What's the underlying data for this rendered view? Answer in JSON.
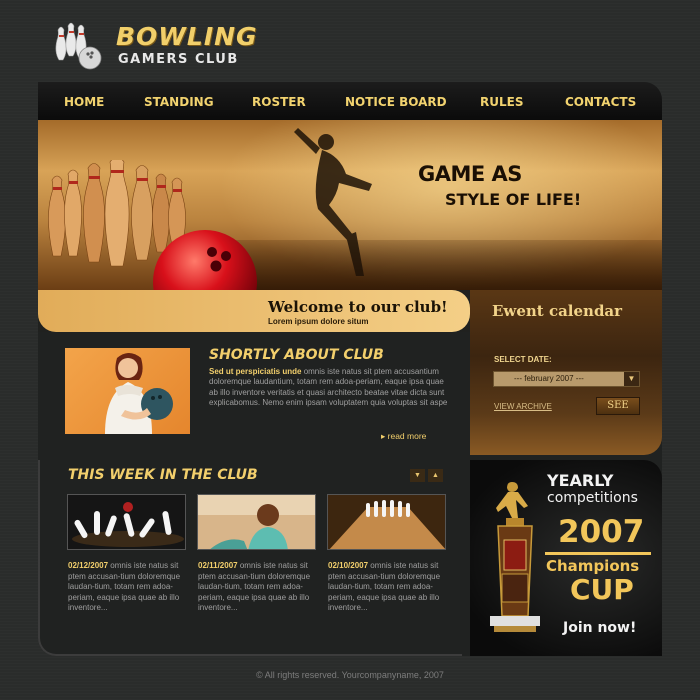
{
  "logo": {
    "title": "BOWLING",
    "subtitle": "GAMERS CLUB"
  },
  "nav": [
    {
      "label": "HOME"
    },
    {
      "label": "STANDING"
    },
    {
      "label": "ROSTER"
    },
    {
      "label": "NOTICE BOARD"
    },
    {
      "label": "RULES"
    },
    {
      "label": "CONTACTS"
    }
  ],
  "hero": {
    "line1": "GAME AS",
    "line2": "STYLE OF LIFE!"
  },
  "welcome": {
    "title": "Welcome to our club!",
    "subtitle": "Lorem ipsum dolore situm"
  },
  "calendar": {
    "title": "Ewent calendar",
    "select_label": "SELECT DATE:",
    "selected_value": "--- february 2007 ---",
    "archive_link": "VIEW ARCHIVE",
    "see_button": "SEE"
  },
  "about": {
    "title": "SHORTLY ABOUT CLUB",
    "lead": "Sed ut perspiciatis unde",
    "text": " omnis iste natus sit ptem accusantium doloremque laudantium, totam rem adoa-periam, eaque ipsa quae ab illo inventore veritatis et quasi architecto beatae vitae dicta sunt explicabomus. Nemo enim ipsam voluptatem quia voluptas sit aspe",
    "read_more": "read more"
  },
  "week": {
    "title": "THIS WEEK IN THE CLUB",
    "prev_icon": "arrow-down-icon",
    "next_icon": "arrow-up-icon",
    "items": [
      {
        "date": "02/12/2007",
        "text": " omnis iste natus sit ptem accusan-tium doloremque laudan-tium, totam rem adoa-periam, eaque ipsa quae ab illo inventore..."
      },
      {
        "date": "02/11/2007",
        "text": " omnis iste natus sit ptem accusan-tium doloremque laudan-tium, totam rem adoa-periam, eaque ipsa quae ab illo inventore..."
      },
      {
        "date": "02/10/2007",
        "text": " omnis iste natus sit ptem accusan-tium doloremque laudan-tium, totam rem adoa-periam, eaque ipsa quae ab illo inventore..."
      }
    ]
  },
  "cup": {
    "yearly": "YEARLY",
    "competitions": "competitions",
    "year": "2007",
    "champions": "Champions",
    "cup": "CUP",
    "join": "Join now!"
  },
  "footer": {
    "text": "© All rights reserved. Yourcompanyname, 2007"
  },
  "colors": {
    "accent": "#f2cf6c",
    "background": "#2a2c2b",
    "hero": "#d8a357"
  }
}
